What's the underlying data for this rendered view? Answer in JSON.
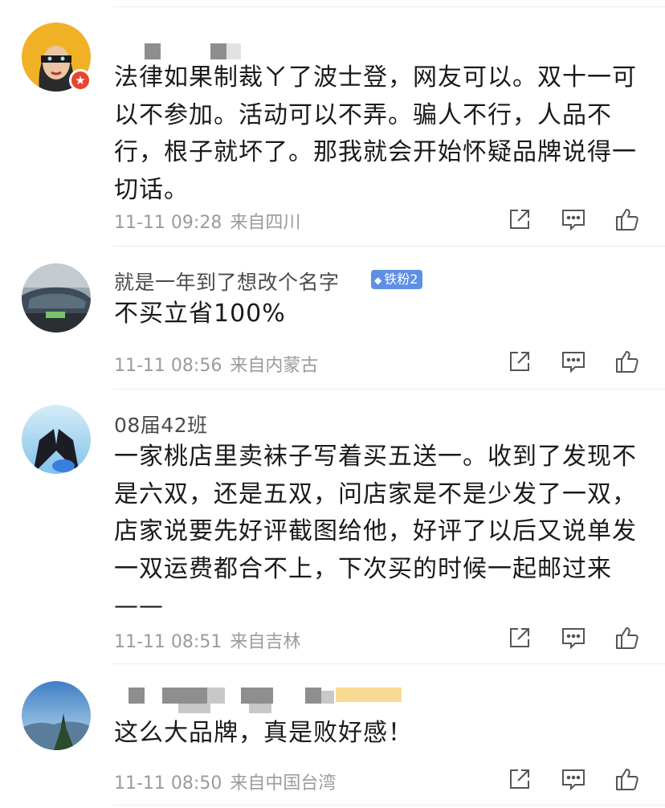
{
  "comments": [
    {
      "username": "",
      "content": "法律如果制裁ㄚ了波士登，网友可以。双十一可以不参加。活动可以不弄。骗人不行，人品不行，根子就坏了。那我就会开始怀疑品牌说得一切话。",
      "time": "11-11 09:28",
      "location": "来自四川",
      "verified_badge": "★"
    },
    {
      "username": "就是一年到了想改个名字",
      "fan_badge": "铁粉2",
      "content": "不买立省100%",
      "time": "11-11 08:56",
      "location": "来自内蒙古"
    },
    {
      "username": "08届42班",
      "content": "一家桃店里卖袜子写着买五送一。收到了发现不是六双，还是五双，问店家是不是少发了一双，店家说要先好评截图给他，好评了以后又说单发一双运费都合不上，下次买的时候一起邮过来——",
      "time": "11-11 08:51",
      "location": "来自吉林"
    },
    {
      "username": "",
      "content": "这么大品牌，真是败好感！",
      "time": "11-11 08:50",
      "location": "来自中国台湾"
    }
  ],
  "icons": {
    "share": "share-icon",
    "reply": "comment-icon",
    "like": "thumbs-up-icon"
  },
  "colors": {
    "fan_badge": "#5d8fe5",
    "verified_badge": "#e8442f",
    "meta_text": "#9b9b9b"
  }
}
